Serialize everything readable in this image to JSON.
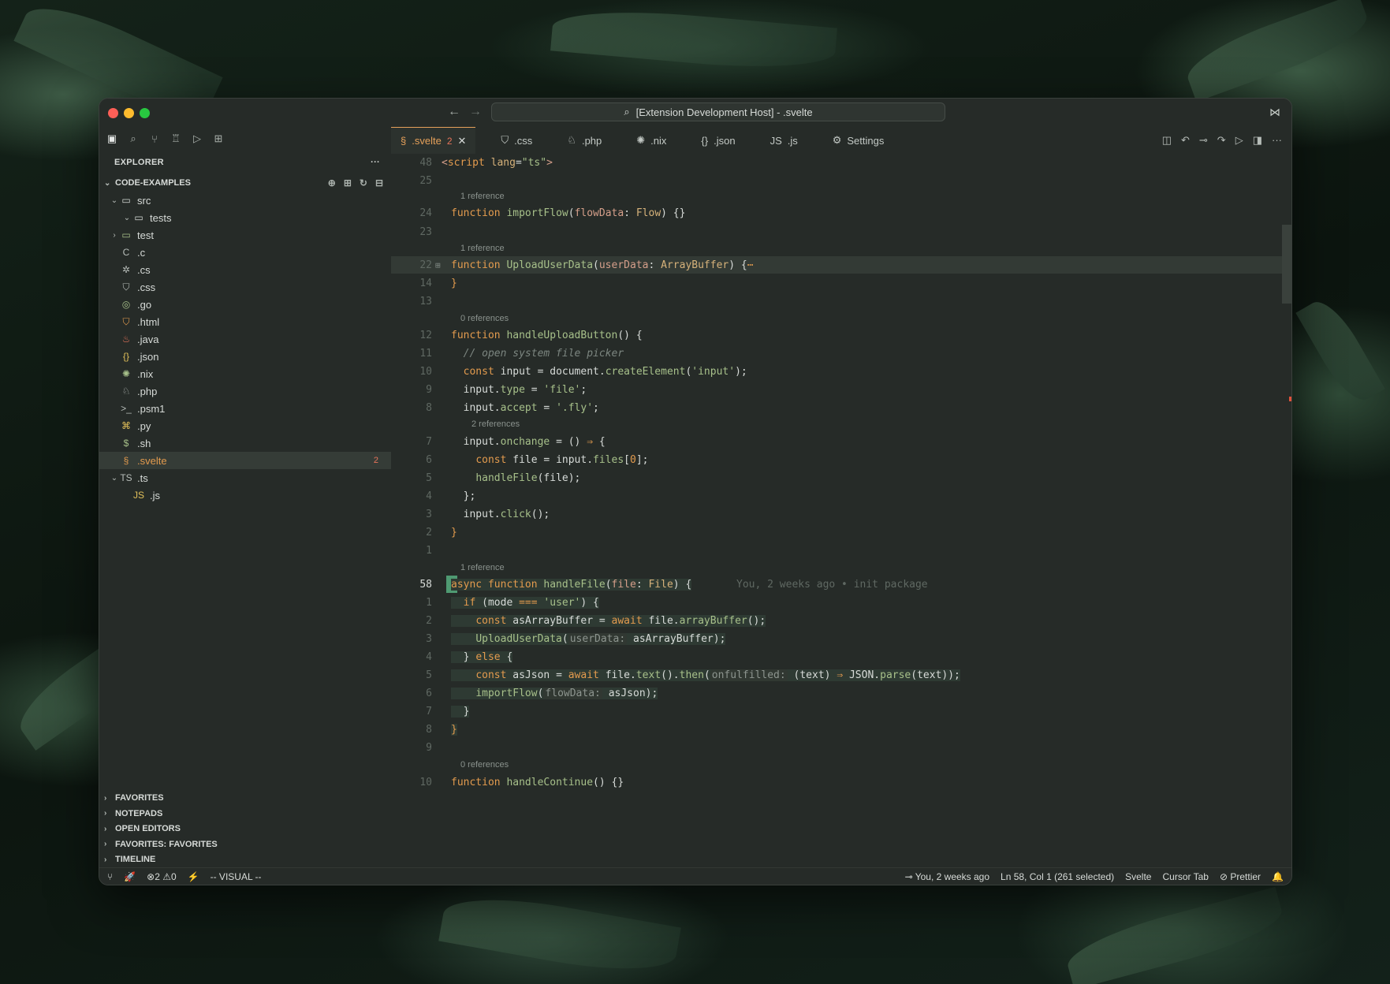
{
  "window": {
    "title": "[Extension Development Host] - .svelte",
    "back_icon": "←",
    "forward_icon": "→",
    "search_icon": "⌕",
    "vscode_logo": "⋈"
  },
  "activity_icons": [
    "▣",
    "⌕",
    "⑂",
    "♖",
    "▷",
    "⊞"
  ],
  "explorer": {
    "title": "EXPLORER",
    "more": "···",
    "root": "CODE-EXAMPLES",
    "root_tools": [
      "⊕",
      "⊞",
      "↻",
      "⊟"
    ],
    "items": [
      {
        "label": "src",
        "depth": 0,
        "chevron": "⌄",
        "icon": "▭",
        "color": "#d7dbd8"
      },
      {
        "label": "tests",
        "depth": 1,
        "chevron": "⌄",
        "icon": "▭",
        "color": "#d7dbd8"
      },
      {
        "label": "test",
        "depth": 0,
        "chevron": "›",
        "icon": "▭",
        "color": "#a7c08a"
      },
      {
        "label": ".c",
        "depth": 0,
        "chevron": "",
        "icon": "C",
        "color": "#b7bdb9"
      },
      {
        "label": ".cs",
        "depth": 0,
        "chevron": "",
        "icon": "✲",
        "color": "#b7bdb9"
      },
      {
        "label": ".css",
        "depth": 0,
        "chevron": "",
        "icon": "⛉",
        "color": "#b7bdb9"
      },
      {
        "label": ".go",
        "depth": 0,
        "chevron": "",
        "icon": "◎",
        "color": "#a7c08a"
      },
      {
        "label": ".html",
        "depth": 0,
        "chevron": "",
        "icon": "⛉",
        "color": "#e39b4e"
      },
      {
        "label": ".java",
        "depth": 0,
        "chevron": "",
        "icon": "♨",
        "color": "#e5735a"
      },
      {
        "label": ".json",
        "depth": 0,
        "chevron": "",
        "icon": "{}",
        "color": "#e3c15a"
      },
      {
        "label": ".nix",
        "depth": 0,
        "chevron": "",
        "icon": "✺",
        "color": "#a7c08a"
      },
      {
        "label": ".php",
        "depth": 0,
        "chevron": "",
        "icon": "♘",
        "color": "#b7bdb9"
      },
      {
        "label": ".psm1",
        "depth": 0,
        "chevron": "",
        "icon": ">_",
        "color": "#b7bdb9"
      },
      {
        "label": ".py",
        "depth": 0,
        "chevron": "",
        "icon": "⌘",
        "color": "#e3c15a"
      },
      {
        "label": ".sh",
        "depth": 0,
        "chevron": "",
        "icon": "$",
        "color": "#a7c08a"
      },
      {
        "label": ".svelte",
        "depth": 0,
        "chevron": "",
        "icon": "§",
        "color": "#e39b4e",
        "selected": true,
        "badge": "2"
      },
      {
        "label": ".ts",
        "depth": 0,
        "chevron": "⌄",
        "icon": "TS",
        "color": "#b7bdb9"
      },
      {
        "label": ".js",
        "depth": 1,
        "chevron": "",
        "icon": "JS",
        "color": "#e3c15a"
      }
    ],
    "bottom_sections": [
      "FAVORITES",
      "NOTEPADS",
      "OPEN EDITORS",
      "FAVORITES: FAVORITES",
      "TIMELINE"
    ]
  },
  "tabs": [
    {
      "label": ".svelte",
      "icon": "§",
      "active": true,
      "badge": "2",
      "close": "✕"
    },
    {
      "label": ".css",
      "icon": "⛉"
    },
    {
      "label": ".php",
      "icon": "♘"
    },
    {
      "label": ".nix",
      "icon": "✺"
    },
    {
      "label": ".json",
      "icon": "{}"
    },
    {
      "label": ".js",
      "icon": "JS"
    },
    {
      "label": "Settings",
      "icon": "⚙"
    }
  ],
  "tab_tools": [
    "◫",
    "↶",
    "⊸",
    "↷",
    "▷",
    "◨",
    "···"
  ],
  "status": {
    "left": [
      "⑂",
      "🚀",
      "⊗2 ⚠0",
      "⚡",
      "-- VISUAL --"
    ],
    "blame": "You, 2 weeks ago",
    "position": "Ln 58, Col 1 (261 selected)",
    "language": "Svelte",
    "cursor_tab": "Cursor Tab",
    "prettier": "Prettier",
    "bell": "🔔"
  },
  "editor": {
    "lens": {
      "l1": "1 reference",
      "l2": "1 reference",
      "l3": "0 references",
      "l4": "2 references",
      "l5": "1 reference",
      "l6": "0 references"
    },
    "numbers": [
      "48",
      "25",
      "24",
      "23",
      "22",
      "14",
      "13",
      "12",
      "11",
      "10",
      "9",
      "8",
      "7",
      "6",
      "5",
      "4",
      "3",
      "2",
      "1",
      "58",
      "1",
      "2",
      "3",
      "4",
      "5",
      "6",
      "7",
      "8",
      "9",
      "10"
    ],
    "blame": "You, 2 weeks ago • init package"
  }
}
